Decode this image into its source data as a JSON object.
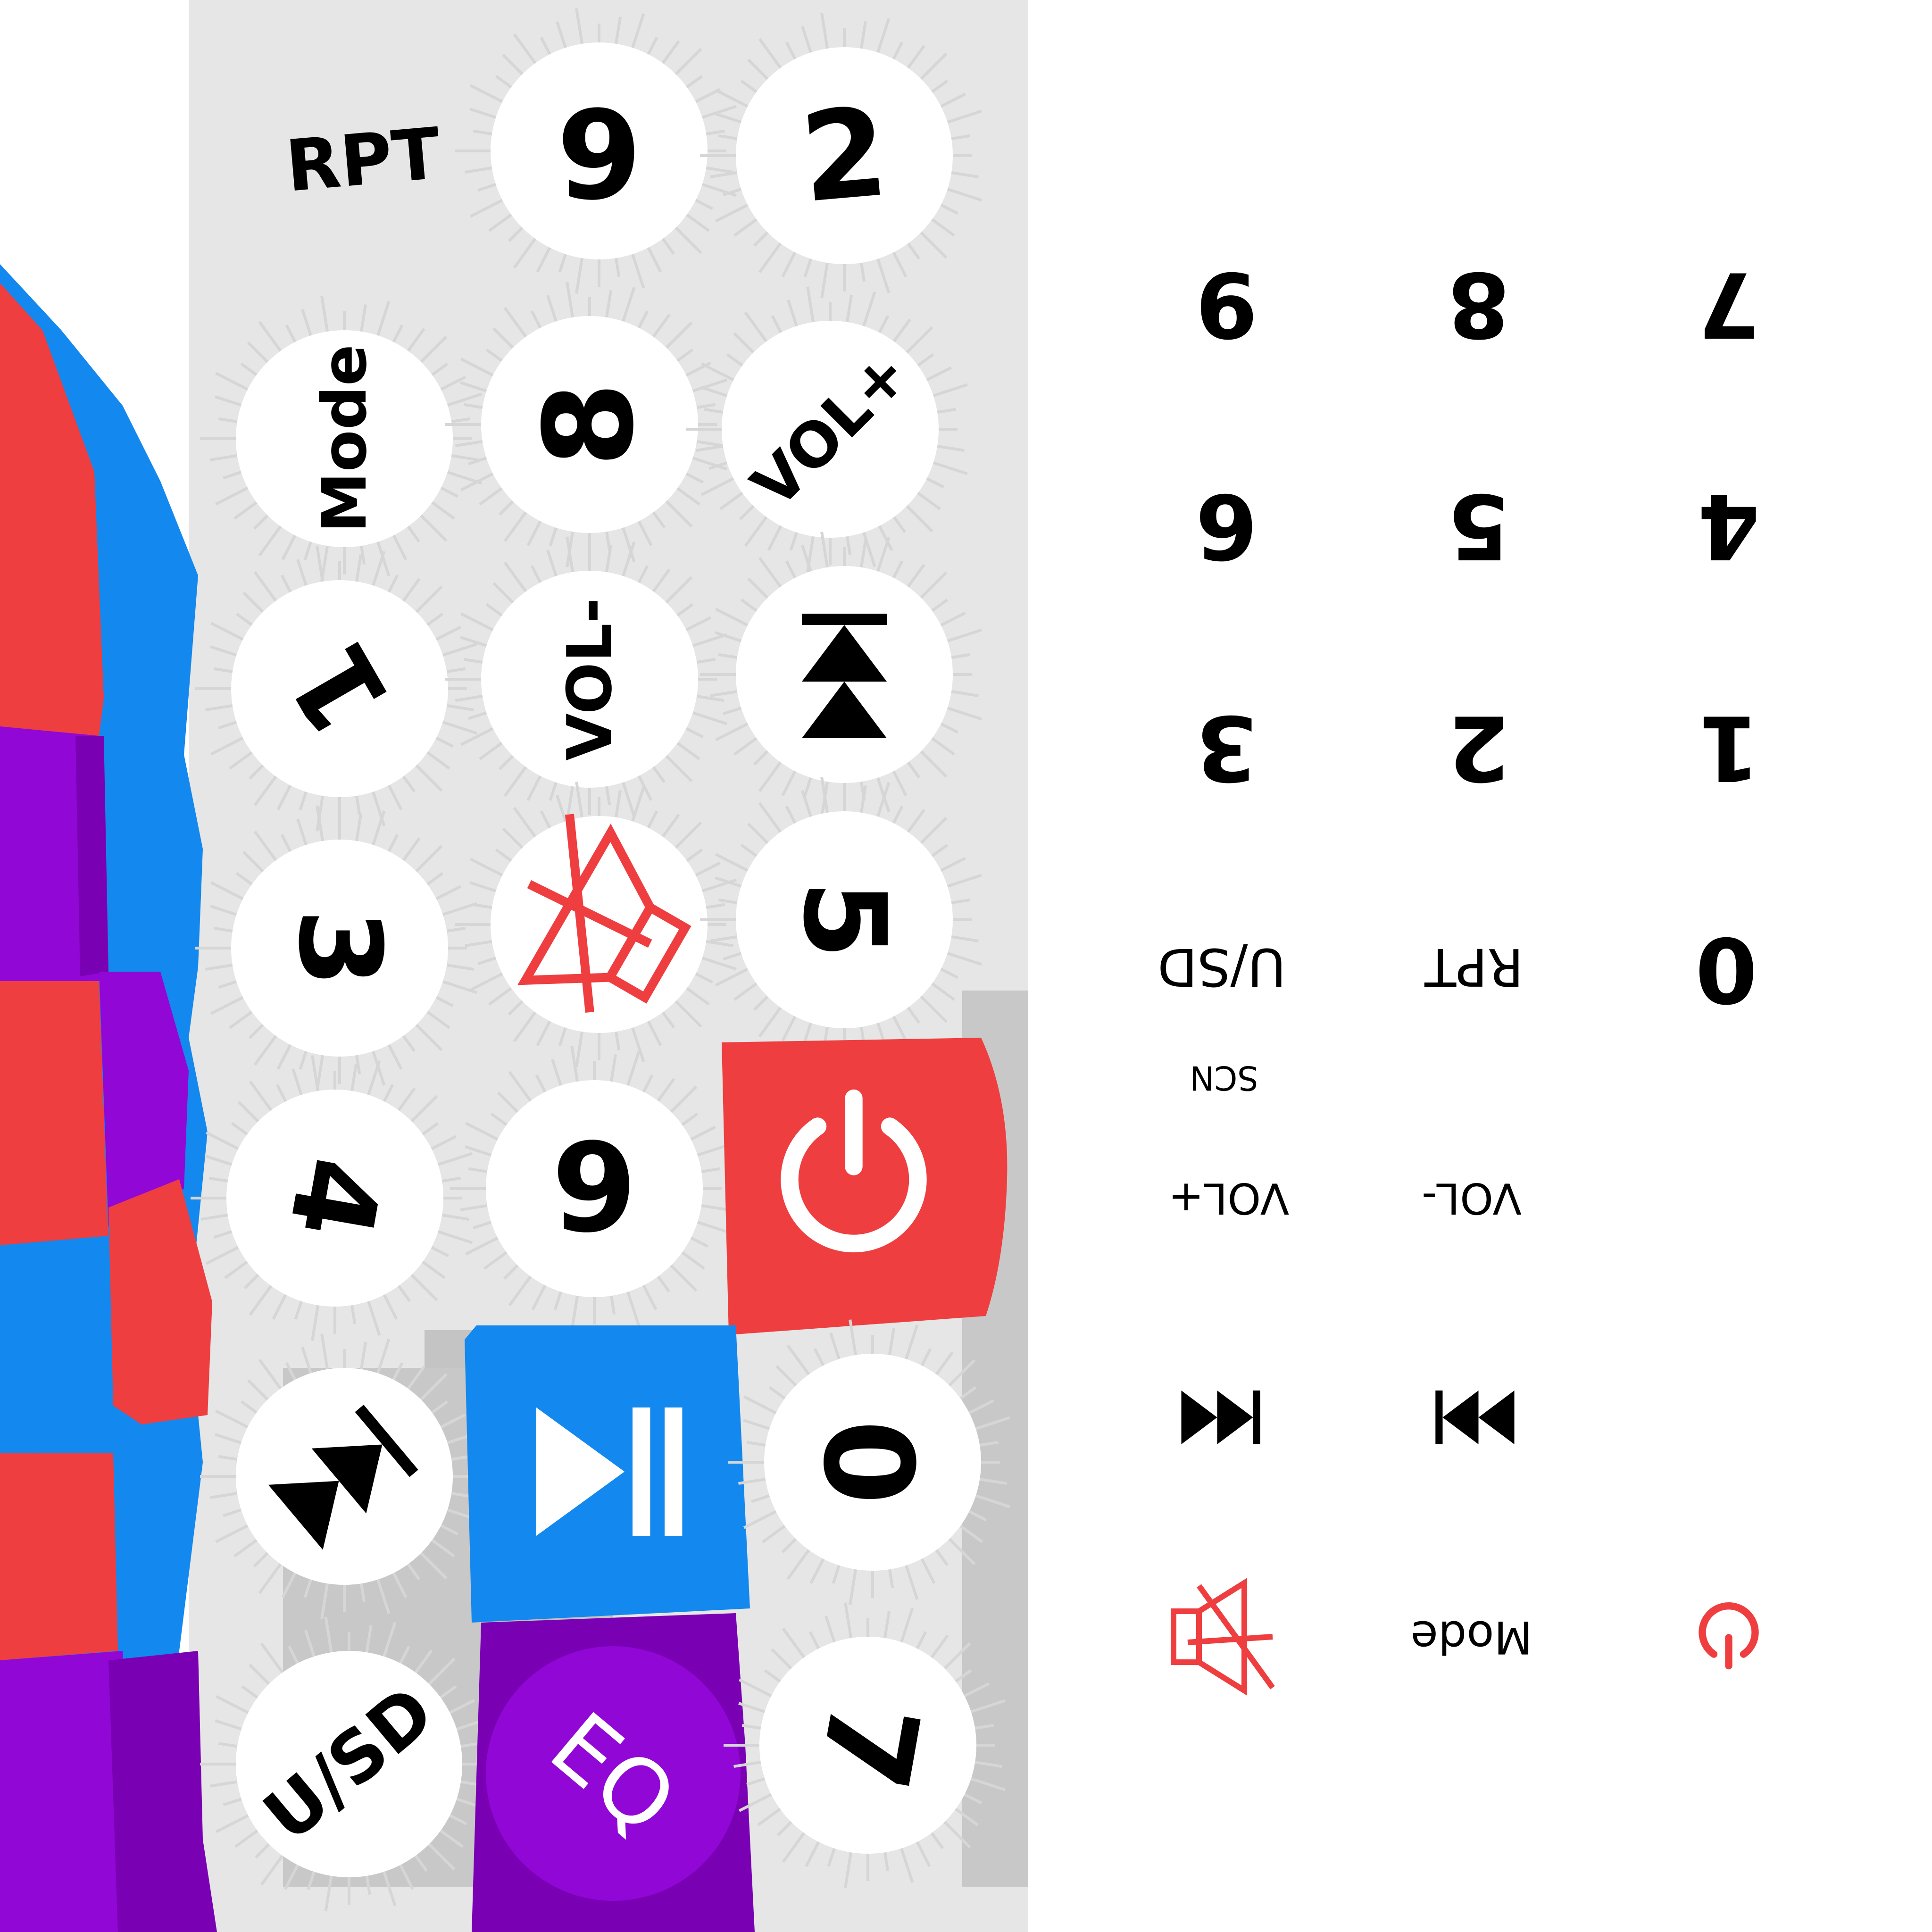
{
  "colors": {
    "red": "#ef3e3f",
    "blue": "#1388ee",
    "purple": "#9007d6",
    "purple_dark": "#7a00b4",
    "black": "#000000",
    "white": "#ffffff",
    "gray": "#bdbdbd"
  },
  "photo_buttons": [
    {
      "id": "rpt",
      "label": "RPT",
      "kind": "text"
    },
    {
      "id": "num-6-top",
      "label": "6",
      "kind": "text"
    },
    {
      "id": "num-2-top",
      "label": "2",
      "kind": "text"
    },
    {
      "id": "mode",
      "label": "Mode",
      "kind": "text"
    },
    {
      "id": "num-8",
      "label": "8",
      "kind": "text"
    },
    {
      "id": "vol-plus",
      "label": "VOL+",
      "kind": "text"
    },
    {
      "id": "num-1",
      "label": "1",
      "kind": "text"
    },
    {
      "id": "vol-minus",
      "label": "VOL-",
      "kind": "text"
    },
    {
      "id": "prev",
      "label": "",
      "kind": "icon",
      "icon": "skip-previous-icon"
    },
    {
      "id": "num-3",
      "label": "3",
      "kind": "text"
    },
    {
      "id": "mute",
      "label": "",
      "kind": "icon",
      "icon": "mute-icon"
    },
    {
      "id": "num-5",
      "label": "5",
      "kind": "text"
    },
    {
      "id": "num-4",
      "label": "4",
      "kind": "text"
    },
    {
      "id": "num-9",
      "label": "9",
      "kind": "text"
    },
    {
      "id": "power",
      "label": "",
      "kind": "icon",
      "icon": "power-icon"
    },
    {
      "id": "next",
      "label": "",
      "kind": "icon",
      "icon": "skip-next-icon"
    },
    {
      "id": "play-pause",
      "label": "",
      "kind": "icon",
      "icon": "play-pause-icon"
    },
    {
      "id": "num-0",
      "label": "0",
      "kind": "text"
    },
    {
      "id": "usd",
      "label": "U/SD",
      "kind": "text"
    },
    {
      "id": "eq",
      "label": "EQ",
      "kind": "text"
    },
    {
      "id": "num-7",
      "label": "7",
      "kind": "text"
    }
  ],
  "panel_labels": [
    {
      "id": "p-9",
      "label": "9",
      "kind": "text"
    },
    {
      "id": "p-8",
      "label": "8",
      "kind": "text"
    },
    {
      "id": "p-7",
      "label": "7",
      "kind": "text"
    },
    {
      "id": "p-6",
      "label": "6",
      "kind": "text"
    },
    {
      "id": "p-5",
      "label": "5",
      "kind": "text"
    },
    {
      "id": "p-4",
      "label": "4",
      "kind": "text"
    },
    {
      "id": "p-3",
      "label": "3",
      "kind": "text"
    },
    {
      "id": "p-2",
      "label": "2",
      "kind": "text"
    },
    {
      "id": "p-1",
      "label": "1",
      "kind": "text"
    },
    {
      "id": "p-usd",
      "label": "U/SD",
      "kind": "text"
    },
    {
      "id": "p-rpt",
      "label": "RPT",
      "kind": "text"
    },
    {
      "id": "p-0",
      "label": "0",
      "kind": "text"
    },
    {
      "id": "p-scn",
      "label": "SCN",
      "kind": "text"
    },
    {
      "id": "p-volp",
      "label": "VOL+",
      "kind": "text"
    },
    {
      "id": "p-volm",
      "label": "VOL-",
      "kind": "text"
    },
    {
      "id": "p-prev",
      "label": "",
      "kind": "icon",
      "icon": "skip-previous-icon"
    },
    {
      "id": "p-next",
      "label": "",
      "kind": "icon",
      "icon": "skip-next-icon"
    },
    {
      "id": "p-mute",
      "label": "",
      "kind": "icon",
      "icon": "mute-icon"
    },
    {
      "id": "p-mode",
      "label": "Mode",
      "kind": "text"
    },
    {
      "id": "p-power",
      "label": "",
      "kind": "icon",
      "icon": "power-icon"
    }
  ]
}
